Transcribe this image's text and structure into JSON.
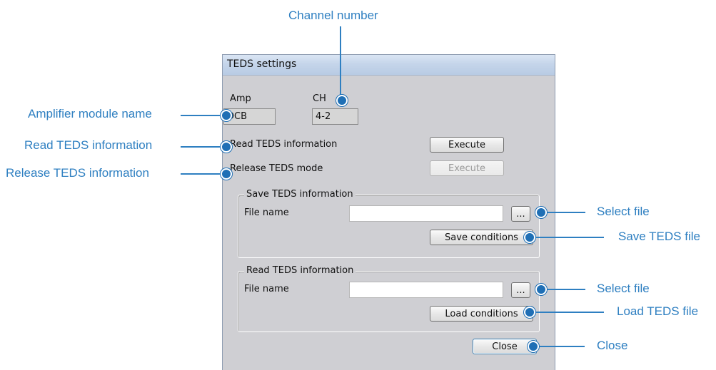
{
  "window": {
    "title": "TEDS settings",
    "amp_label": "Amp",
    "amp_value": "DCB",
    "ch_label": "CH",
    "ch_value": "4-2",
    "read_info_label": "Read TEDS information",
    "read_info_button": "Execute",
    "release_mode_label": "Release TEDS mode",
    "release_mode_button": "Execute",
    "save_group": {
      "legend": "Save TEDS information",
      "file_name_label": "File name",
      "file_name_value": "",
      "browse_label": "...",
      "action_label": "Save conditions"
    },
    "read_group": {
      "legend": "Read TEDS information",
      "file_name_label": "File name",
      "file_name_value": "",
      "browse_label": "...",
      "action_label": "Load conditions"
    },
    "close_button": "Close"
  },
  "callouts": {
    "channel_number": "Channel number",
    "amplifier_module_name": "Amplifier module name",
    "read_teds_information": "Read TEDS information",
    "release_teds_information": "Release TEDS information",
    "select_file_1": "Select file",
    "save_teds_file": "Save TEDS file",
    "select_file_2": "Select file",
    "load_teds_file": "Load TEDS file",
    "close": "Close"
  },
  "colors": {
    "callout": "#2e7fc1",
    "dot": "#1f6fb5",
    "window_bg": "#cfcfd3",
    "titlebar": "#c5d5ea"
  }
}
